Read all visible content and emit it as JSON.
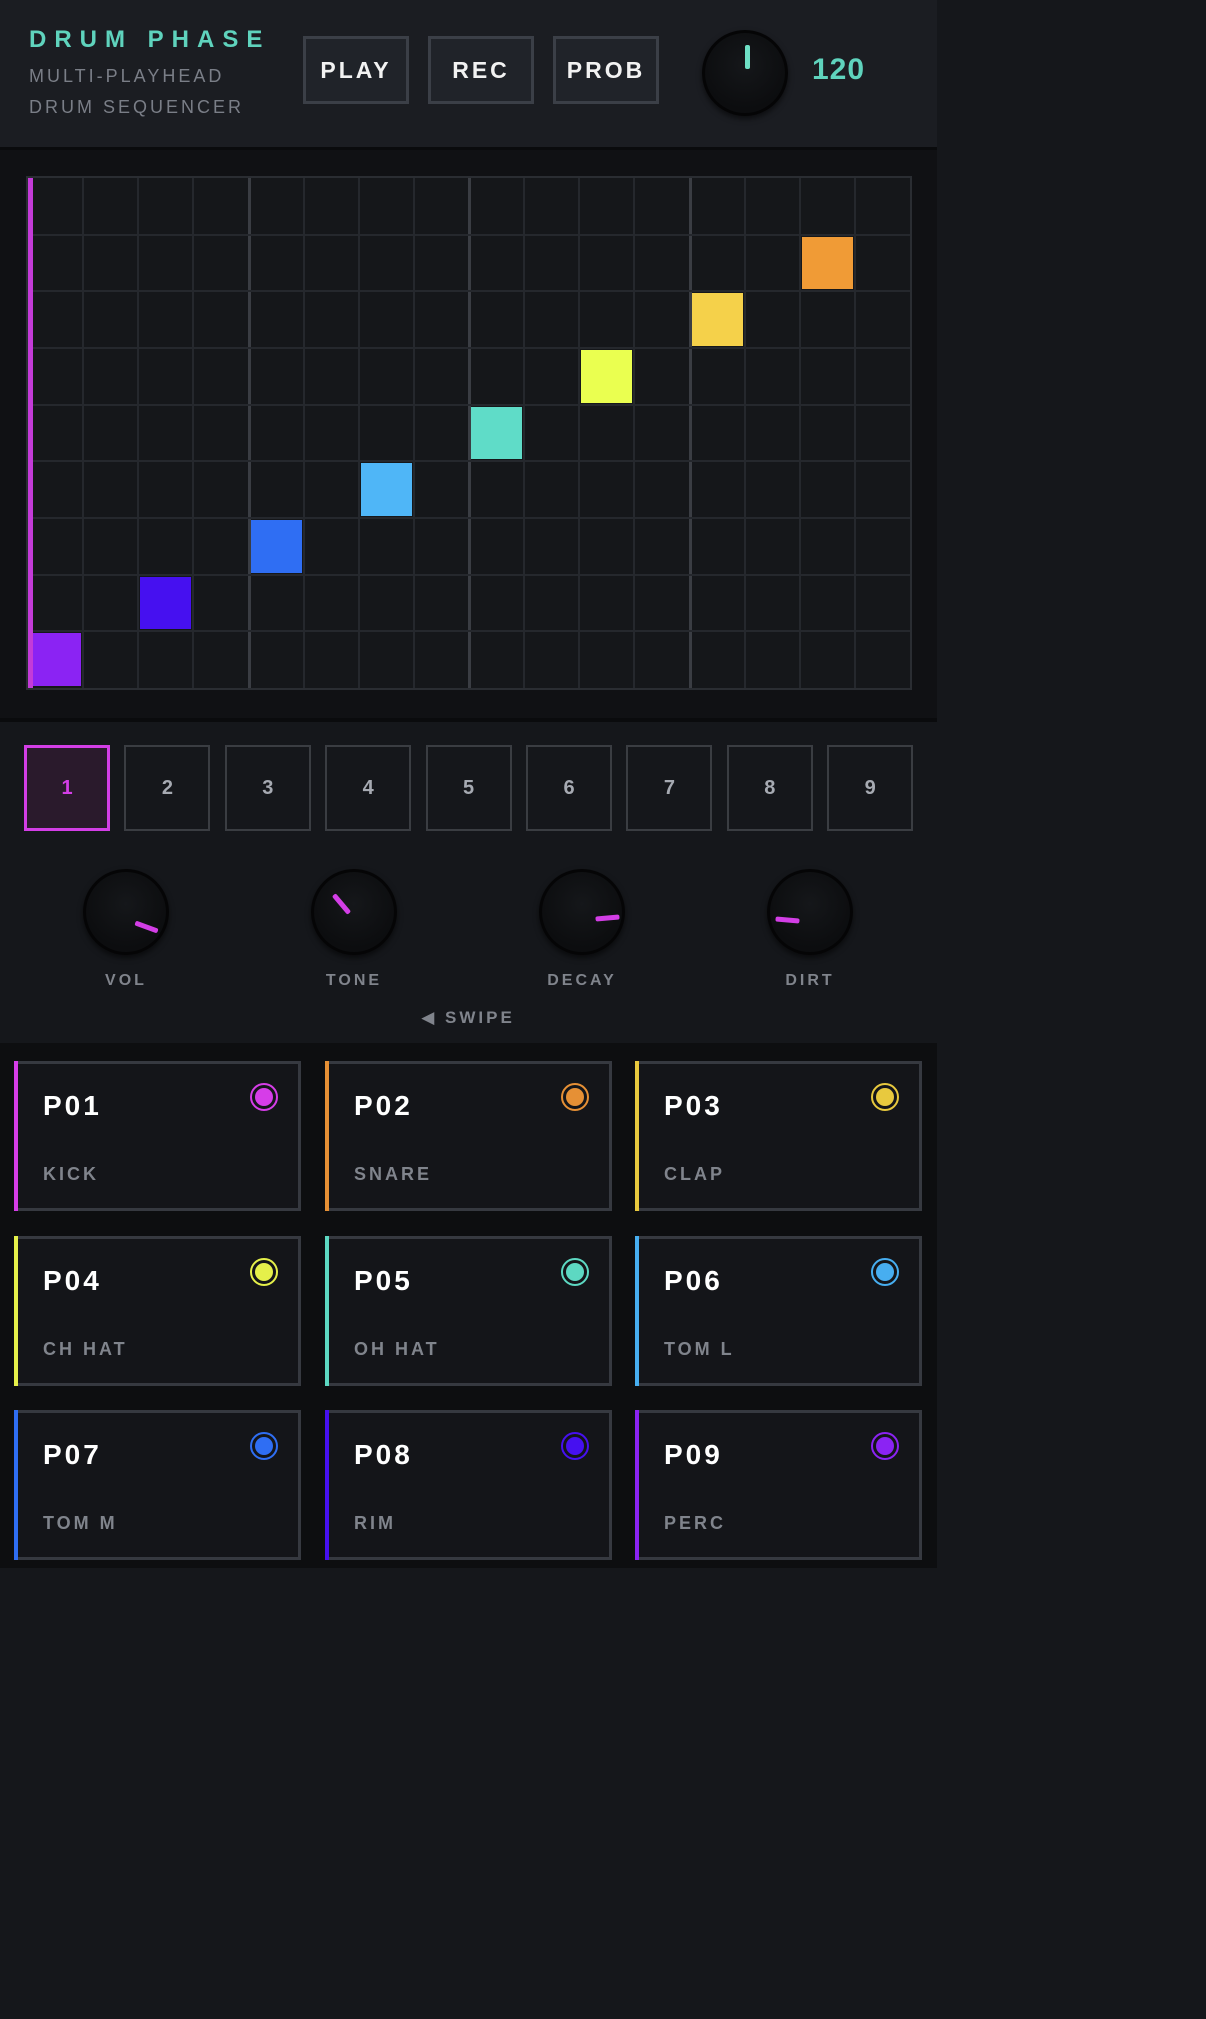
{
  "header": {
    "title": "DRUM PHASE",
    "subtitle_line1": "MULTI-PLAYHEAD",
    "subtitle_line2": "DRUM SEQUENCER",
    "buttons": {
      "play": "PLAY",
      "rec": "REC",
      "prob": "PROB"
    },
    "tempo": "120"
  },
  "sequencer": {
    "columns": 16,
    "rows": 9,
    "notes": [
      {
        "step": 1,
        "row": 9,
        "color": "#8b23f3"
      },
      {
        "step": 3,
        "row": 8,
        "color": "#4610f0"
      },
      {
        "step": 5,
        "row": 7,
        "color": "#2f6ef3"
      },
      {
        "step": 7,
        "row": 6,
        "color": "#4fb6f7"
      },
      {
        "step": 9,
        "row": 5,
        "color": "#5fdcc8"
      },
      {
        "step": 11,
        "row": 4,
        "color": "#eaff50"
      },
      {
        "step": 13,
        "row": 3,
        "color": "#f5d14a"
      },
      {
        "step": 15,
        "row": 2,
        "color": "#f09b36"
      }
    ],
    "playhead_color": "#c43bd8"
  },
  "tracks": [
    "1",
    "2",
    "3",
    "4",
    "5",
    "6",
    "7",
    "8",
    "9"
  ],
  "params": {
    "vol": "VOL",
    "tone": "TONE",
    "decay": "DECAY",
    "dirt": "DIRT"
  },
  "swipe_hint": "◀ SWIPE",
  "pads": [
    {
      "id": "P01",
      "name": "KICK",
      "color": "#d63de8"
    },
    {
      "id": "P02",
      "name": "SNARE",
      "color": "#e69035"
    },
    {
      "id": "P03",
      "name": "CLAP",
      "color": "#e8c93e"
    },
    {
      "id": "P04",
      "name": "CH HAT",
      "color": "#e5f04a"
    },
    {
      "id": "P05",
      "name": "OH HAT",
      "color": "#5dd8c2"
    },
    {
      "id": "P06",
      "name": "TOM L",
      "color": "#47aef0"
    },
    {
      "id": "P07",
      "name": "TOM M",
      "color": "#2f6ef3"
    },
    {
      "id": "P08",
      "name": "RIM",
      "color": "#4610f0"
    },
    {
      "id": "P09",
      "name": "PERC",
      "color": "#8b23f3"
    }
  ]
}
